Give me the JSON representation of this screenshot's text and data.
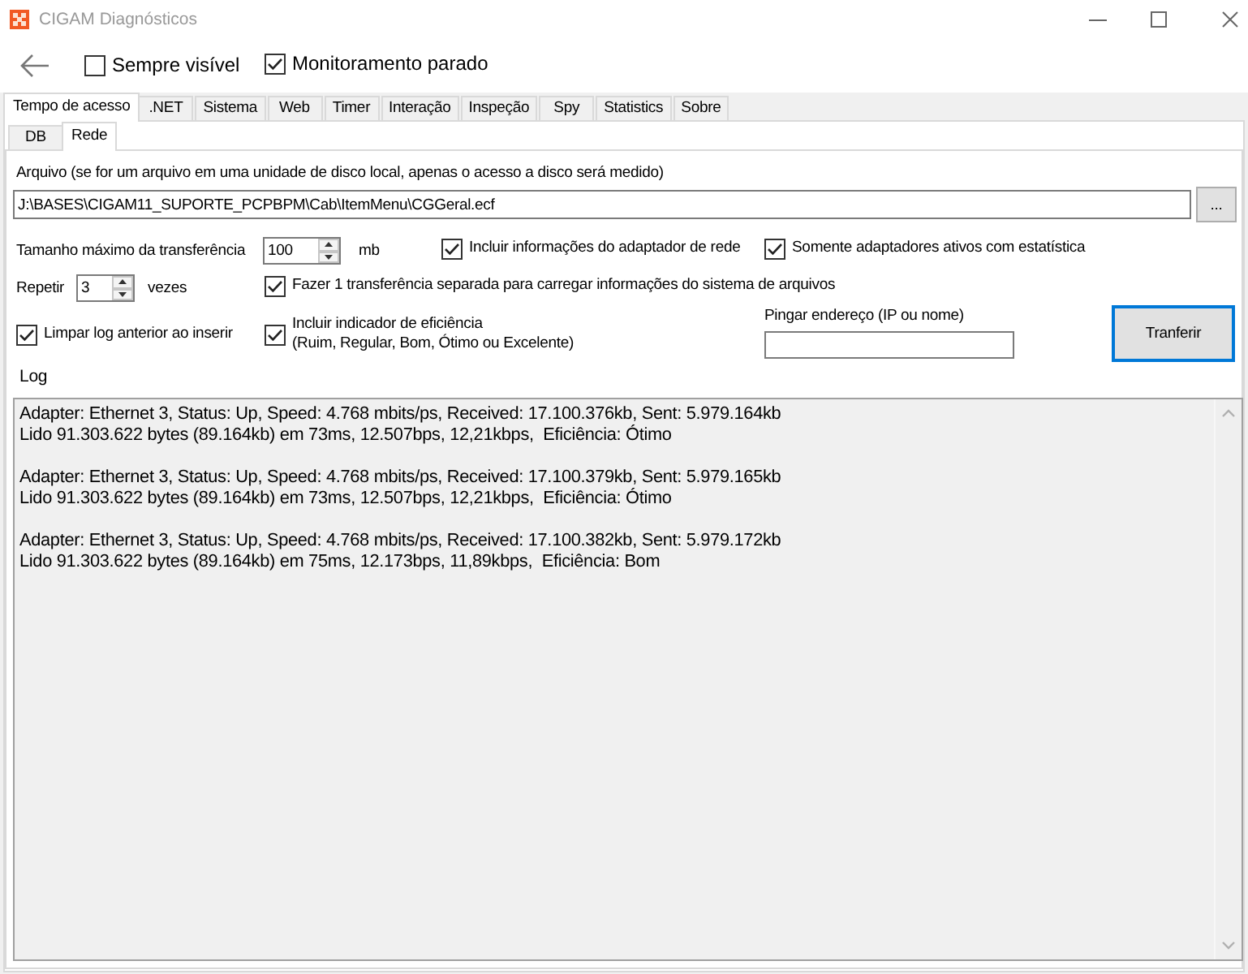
{
  "window": {
    "title": "CIGAM Diagnósticos"
  },
  "toolbar": {
    "checkboxes": [
      {
        "label": "Sempre visível",
        "checked": false
      },
      {
        "label": "Monitoramento parado",
        "checked": true
      }
    ]
  },
  "tabs": [
    {
      "label": "Tempo de acesso",
      "selected": true
    },
    {
      "label": ".NET",
      "selected": false
    },
    {
      "label": "Sistema",
      "selected": false
    },
    {
      "label": "Web",
      "selected": false
    },
    {
      "label": "Timer",
      "selected": false
    },
    {
      "label": "Interação",
      "selected": false
    },
    {
      "label": "Inspeção",
      "selected": false
    },
    {
      "label": "Spy",
      "selected": false
    },
    {
      "label": "Statistics",
      "selected": false
    },
    {
      "label": "Sobre",
      "selected": false
    }
  ],
  "subtabs": [
    {
      "label": "DB",
      "selected": false
    },
    {
      "label": "Rede",
      "selected": true
    }
  ],
  "file": {
    "label": "Arquivo (se for um arquivo em uma unidade de disco local, apenas o acesso a disco será medido)",
    "value": "J:\\BASES\\CIGAM11_SUPORTE_PCPBPM\\Cab\\ItemMenu\\CGGeral.ecf",
    "browse_button": "..."
  },
  "transfer_size": {
    "label": "Tamanho máximo da transferência",
    "value": "100",
    "unit": "mb"
  },
  "repeat": {
    "label": "Repetir",
    "value": "3",
    "unit": "vezes"
  },
  "options": [
    {
      "label": "Incluir informações do adaptador de rede",
      "checked": true
    },
    {
      "label": "Somente adaptadores ativos com estatística",
      "checked": true
    },
    {
      "label": "Fazer 1 transferência separada para carregar informações do sistema de arquivos",
      "checked": true
    },
    {
      "label": "Limpar log anterior ao inserir",
      "checked": true
    },
    {
      "label": "Incluir indicador de eficiência\n(Ruim, Regular, Bom, Ótimo ou Excelente)",
      "checked": true
    }
  ],
  "ping": {
    "label": "Pingar endereço (IP ou nome)"
  },
  "transfer_button": {
    "label": "Tranferir",
    "focused": true
  },
  "log": {
    "label": "Log",
    "entries": [
      {
        "lines": [
          "Adapter: Ethernet 3, Status: Up, Speed: 4.768 mbits/ps, Received: 17.100.376kb, Sent: 5.979.164kb",
          "Lido 91.303.622 bytes (89.164kb) em 73ms, 12.507bps, 12,21kbps,  Eficiência: Ótimo"
        ]
      },
      {
        "lines": [
          "Adapter: Ethernet 3, Status: Up, Speed: 4.768 mbits/ps, Received: 17.100.379kb, Sent: 5.979.165kb",
          "Lido 91.303.622 bytes (89.164kb) em 73ms, 12.507bps, 12,21kbps,  Eficiência: Ótimo"
        ]
      },
      {
        "lines": [
          "Adapter: Ethernet 3, Status: Up, Speed: 4.768 mbits/ps, Received: 17.100.382kb, Sent: 5.979.172kb",
          "Lido 91.303.622 bytes (89.164kb) em 75ms, 12.173bps, 11,89kbps,  Eficiência: Bom"
        ]
      }
    ]
  }
}
